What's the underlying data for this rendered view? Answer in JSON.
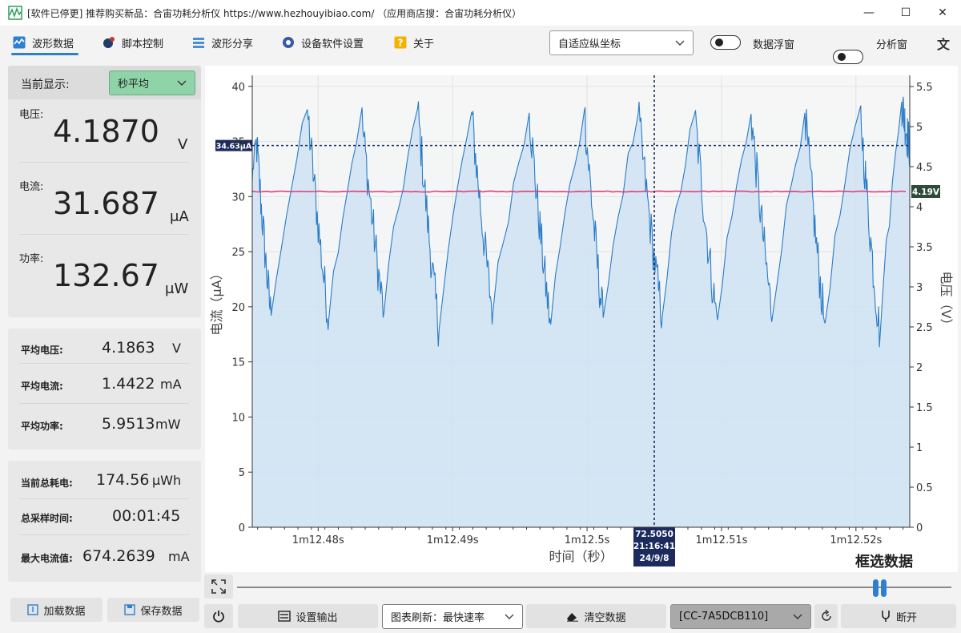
{
  "window": {
    "title": "[软件已停更] 推荐购买新品：合宙功耗分析仪 https://www.hezhouyibiao.com/ （应用商店搜：合宙功耗分析仪）",
    "minimize_symbol": "—",
    "maximize_symbol": "☐",
    "close_symbol": "✕"
  },
  "menu": {
    "items": [
      {
        "label": "波形数据",
        "icon": "waveform-icon",
        "active": true
      },
      {
        "label": "脚本控制",
        "icon": "script-icon"
      },
      {
        "label": "波形分享",
        "icon": "share-icon"
      },
      {
        "label": "设备软件设置",
        "icon": "gear-icon"
      },
      {
        "label": "关于",
        "icon": "help-icon"
      }
    ],
    "axis_mode": "自适应纵坐标",
    "toggle_float_label": "数据浮窗",
    "toggle_analysis_label": "分析窗",
    "language_icon": "translate-icon"
  },
  "display": {
    "label": "当前显示:",
    "mode": "秒平均",
    "voltage_label": "电压:",
    "voltage_value": "4.1870",
    "voltage_unit": "V",
    "current_label": "电流:",
    "current_value": "31.687",
    "current_unit": "μA",
    "power_label": "功率:",
    "power_value": "132.67",
    "power_unit": "μW"
  },
  "averages": {
    "avg_voltage_label": "平均电压:",
    "avg_voltage_value": "4.1863",
    "avg_voltage_unit": "V",
    "avg_current_label": "平均电流:",
    "avg_current_value": "1.4422",
    "avg_current_unit": "mA",
    "avg_power_label": "平均功率:",
    "avg_power_value": "5.9513",
    "avg_power_unit": "mW"
  },
  "totals": {
    "energy_label": "当前总耗电:",
    "energy_value": "174.56",
    "energy_unit": "μWh",
    "time_label": "总采样时间:",
    "time_value": "00:01:45",
    "max_current_label": "最大电流值:",
    "max_current_value": "674.2639",
    "max_current_unit": "mA"
  },
  "buttons": {
    "load": "加载数据",
    "save": "保存数据",
    "set_output": "设置输出",
    "refresh": "图表刷新：最快速率",
    "clear": "清空数据",
    "device": "[CC-7A5DCB110]",
    "disconnect": "断开",
    "select_data": "框选数据"
  },
  "colors": {
    "accent": "#2f7fd0",
    "current_line": "#2a7cc7",
    "current_fill": "#cfe2f3",
    "voltage_line": "#e0407a",
    "combo_green": "#8fd4a8",
    "cursor_tag": "#1c2b5e",
    "voltage_tag": "#2e4a3a"
  },
  "chart_data": {
    "type": "line",
    "xlabel": "时间（秒）",
    "ylabel": "电流（μA）",
    "y2label": "电压（V）",
    "ylim": [
      0,
      41
    ],
    "y2lim": [
      0,
      5.64
    ],
    "yticks": [
      0,
      5,
      10,
      15,
      20,
      25,
      30,
      35,
      40
    ],
    "y2ticks": [
      0,
      0.5,
      1,
      1.5,
      2,
      2.5,
      3,
      3.5,
      4,
      4.5,
      5,
      5.5
    ],
    "xlim": [
      72.4751,
      72.524
    ],
    "xticks": [
      {
        "value": 72.48,
        "label": "1m12.48s"
      },
      {
        "value": 72.49,
        "label": "1m12.49s"
      },
      {
        "value": 72.5,
        "label": "1m12.5s"
      },
      {
        "value": 72.51,
        "label": "1m12.51s"
      },
      {
        "value": 72.52,
        "label": "1m12.52s"
      }
    ],
    "grid": true,
    "series": [
      {
        "axis": "left",
        "peaks": [
          {
            "t": 72.4754,
            "v": 35.2
          },
          {
            "t": 72.4792,
            "v": 37.9
          },
          {
            "t": 72.4832,
            "v": 37.6
          },
          {
            "t": 72.4874,
            "v": 38.0
          },
          {
            "t": 72.4914,
            "v": 37.6
          },
          {
            "t": 72.4957,
            "v": 37.6
          },
          {
            "t": 72.4998,
            "v": 37.8
          },
          {
            "t": 72.5038,
            "v": 37.5
          },
          {
            "t": 72.508,
            "v": 37.5
          },
          {
            "t": 72.5122,
            "v": 37.5
          },
          {
            "t": 72.5162,
            "v": 37.6
          },
          {
            "t": 72.5203,
            "v": 38.0
          },
          {
            "t": 72.5234,
            "v": 38.6
          }
        ],
        "troughs": [
          {
            "t": 72.4765,
            "v": 19.2
          },
          {
            "t": 72.4808,
            "v": 19.0
          },
          {
            "t": 72.4849,
            "v": 19.5
          },
          {
            "t": 72.489,
            "v": 18.0
          },
          {
            "t": 72.493,
            "v": 19.5
          },
          {
            "t": 72.4973,
            "v": 18.4
          },
          {
            "t": 72.5012,
            "v": 19.0
          },
          {
            "t": 72.5056,
            "v": 19.2
          },
          {
            "t": 72.5097,
            "v": 18.8
          },
          {
            "t": 72.5138,
            "v": 19.2
          },
          {
            "t": 72.5177,
            "v": 18.5
          },
          {
            "t": 72.5218,
            "v": 17.5
          }
        ]
      },
      {
        "axis": "right",
        "value": 4.19
      }
    ],
    "cursor": {
      "time_label": "72.5050",
      "clock": "21:16:41",
      "date": "24/9/8"
    },
    "hline_current": {
      "value": 34.63,
      "label": "34.63μA"
    },
    "voltage_tag": "4.19V"
  }
}
